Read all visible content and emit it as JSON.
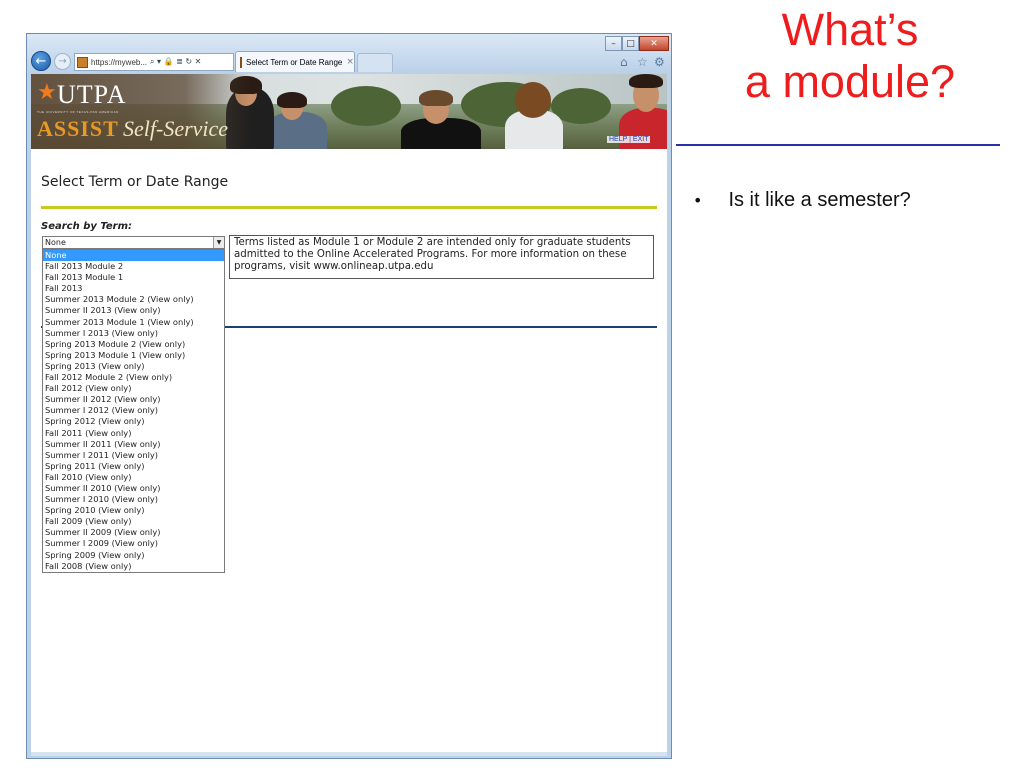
{
  "browser": {
    "address_text": "https://myweb...",
    "address_icons": "⌕ ▾ 🔒 ≣ ↻ ✕",
    "tab_title": "Select Term or Date Range",
    "tab_close": "×",
    "controls": {
      "minimize": "–",
      "maximize": "□",
      "close": "✕"
    },
    "toolbar": {
      "home": "⌂",
      "favorites": "☆",
      "tools": "⚙"
    }
  },
  "banner": {
    "logo_name": "UTPA",
    "logo_subtitle": "THE UNIVERSITY OF TEXAS-PAN AMERICAN",
    "logo_assist": "ASSIST",
    "logo_self_service": "Self-Service",
    "help_label": "HELP",
    "help_separator": "|",
    "exit_label": "EXIT"
  },
  "page": {
    "title": "Select Term or Date Range",
    "search_label": "Search by Term:",
    "selected_value": "None",
    "term_options": [
      "None",
      "Fall 2013 Module 2",
      "Fall 2013 Module 1",
      "Fall 2013",
      "Summer 2013 Module 2 (View only)",
      "Summer II 2013 (View only)",
      "Summer 2013 Module 1 (View only)",
      "Summer I 2013 (View only)",
      "Spring 2013 Module 2 (View only)",
      "Spring 2013 Module 1 (View only)",
      "Spring 2013 (View only)",
      "Fall 2012 Module 2 (View only)",
      "Fall 2012 (View only)",
      "Summer II 2012 (View only)",
      "Summer I 2012 (View only)",
      "Spring 2012 (View only)",
      "Fall 2011 (View only)",
      "Summer II 2011 (View only)",
      "Summer I 2011 (View only)",
      "Spring 2011 (View only)",
      "Fall 2010 (View only)",
      "Summer II 2010 (View only)",
      "Summer I 2010 (View only)",
      "Spring 2010 (View only)",
      "Fall 2009 (View only)",
      "Summer II 2009 (View only)",
      "Summer I 2009 (View only)",
      "Spring 2009 (View only)",
      "Fall 2008 (View only)"
    ],
    "info_text": "Terms listed as Module 1 or Module 2 are intended only for graduate students admitted to the Online Accelerated Programs. For more information on these programs, visit www.onlineap.utpa.edu"
  },
  "slide": {
    "title_line1": "What’s",
    "title_line2": "a module?",
    "bullet_marker": "•",
    "bullet": "Is it like a semester?"
  },
  "colors": {
    "slide_title": "#ee1c1c",
    "slide_rule": "#2b2fa8",
    "yellow_rule": "#c9c81e",
    "blue_rule": "#1d3e78",
    "selection": "#3399ff",
    "assist_orange": "#e99a26"
  }
}
